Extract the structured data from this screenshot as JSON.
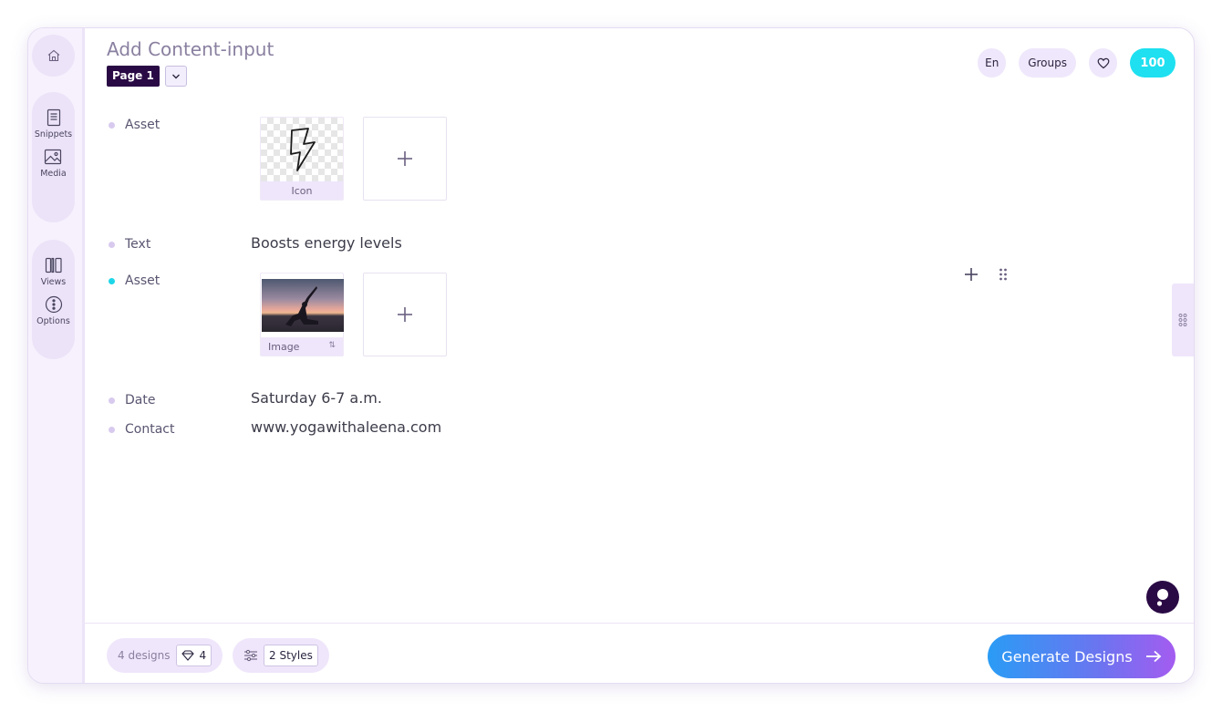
{
  "header": {
    "title": "Add Content-input",
    "page_label": "Page 1",
    "language": "En",
    "groups_label": "Groups",
    "credits": "100"
  },
  "sidebar": {
    "items": [
      {
        "label": "Snippets",
        "icon": "document-icon"
      },
      {
        "label": "Media",
        "icon": "image-icon"
      },
      {
        "label": "Views",
        "icon": "columns-icon"
      },
      {
        "label": "Options",
        "icon": "options-icon"
      }
    ]
  },
  "content": {
    "rows": [
      {
        "label": "Asset",
        "type": "asset",
        "tile_caption": "Icon"
      },
      {
        "label": "Text",
        "type": "text",
        "value": "Boosts energy levels"
      },
      {
        "label": "Asset",
        "type": "asset",
        "tile_caption": "Image",
        "active": true
      },
      {
        "label": "Date",
        "type": "text",
        "value": "Saturday 6-7 a.m."
      },
      {
        "label": "Contact",
        "type": "text",
        "value": "www.yogawithaleena.com"
      }
    ]
  },
  "footer": {
    "designs_label": "4 designs",
    "favorites_count": "4",
    "styles_label": "2 Styles",
    "generate_label": "Generate Designs"
  },
  "colors": {
    "accent_cyan": "#1ee0f0",
    "page_badge": "#2a0a45",
    "sidebar_bg": "#f6f1fd",
    "generate_gradient_start": "#2a9cf5",
    "generate_gradient_end": "#a45cf0"
  }
}
